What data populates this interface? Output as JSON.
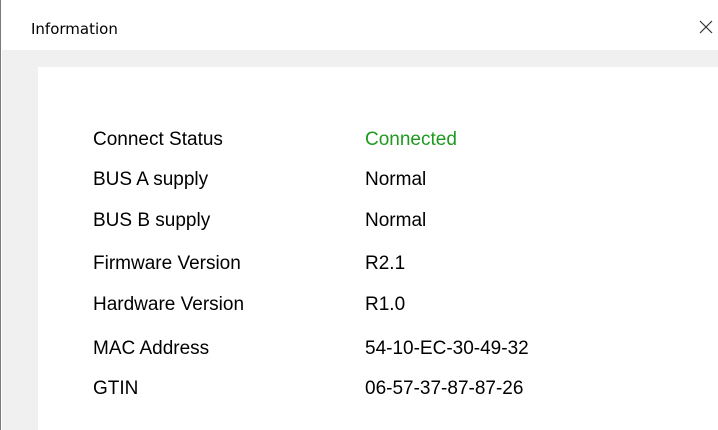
{
  "window": {
    "title": "Information",
    "close_icon": "close-icon"
  },
  "info": {
    "rows": [
      {
        "label": "Connect Status",
        "value": "Connected",
        "value_color": "#1f9a1f"
      },
      {
        "label": "BUS A supply",
        "value": "Normal"
      },
      {
        "label": "BUS B supply",
        "value": "Normal"
      },
      {
        "label": "Firmware Version",
        "value": "R2.1"
      },
      {
        "label": "Hardware Version",
        "value": "R1.0"
      },
      {
        "label": "MAC Address",
        "value": "54-10-EC-30-49-32"
      },
      {
        "label": "GTIN",
        "value": "06-57-37-87-87-26"
      }
    ]
  }
}
